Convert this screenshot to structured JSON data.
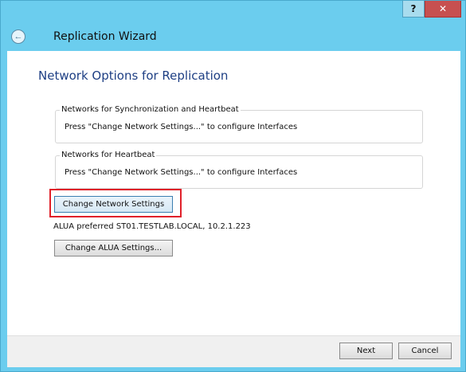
{
  "window": {
    "help_label": "?",
    "close_label": "✕"
  },
  "header": {
    "title": "Replication Wizard",
    "back_glyph": "←"
  },
  "page": {
    "heading": "Network Options for Replication",
    "sync_group": {
      "legend": "Networks for Synchronization and Heartbeat",
      "text": "Press \"Change Network Settings...\" to configure Interfaces"
    },
    "heartbeat_group": {
      "legend": "Networks for Heartbeat",
      "text": "Press \"Change Network Settings...\" to configure Interfaces"
    },
    "change_network_label": "Change Network Settings",
    "alua_text": "ALUA preferred ST01.TESTLAB.LOCAL, 10.2.1.223",
    "change_alua_label": "Change ALUA Settings..."
  },
  "footer": {
    "next_label": "Next",
    "cancel_label": "Cancel"
  },
  "colors": {
    "frame": "#6bcdee",
    "heading": "#1e3f84",
    "highlight": "#e0202a",
    "close": "#c75050"
  }
}
